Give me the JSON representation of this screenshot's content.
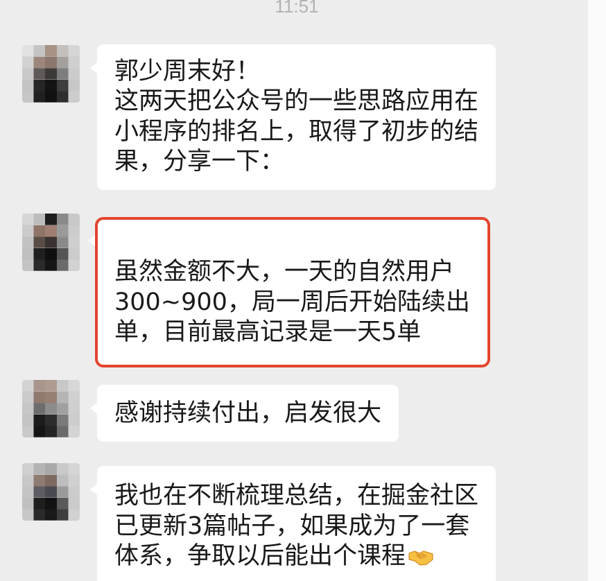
{
  "timestamp": "11:51",
  "colors": {
    "background": "#ededed",
    "bubble": "#ffffff",
    "text": "#191919",
    "timestamp": "#b2b2b2",
    "highlight_border": "#e3452f"
  },
  "messages": [
    {
      "lines": [
        "郭少周末好！",
        "这两天把公众号的一些思路应用在",
        "小程序的排名上，取得了初步的结",
        "果，分享一下："
      ]
    },
    {
      "highlighted": true,
      "lines": [
        "虽然金额不大，一天的自然用户",
        "300~900，局一周后开始陆续出",
        "单，目前最高记录是一天5单"
      ]
    },
    {
      "lines": [
        "感谢持续付出，启发很大"
      ]
    },
    {
      "lines": [
        "我也在不断梳理总结，在掘金社区",
        "已更新3篇帖子，如果成为了一套",
        "体系，争取以后能出个课程"
      ],
      "trailing_emoji": "handshake"
    }
  ]
}
